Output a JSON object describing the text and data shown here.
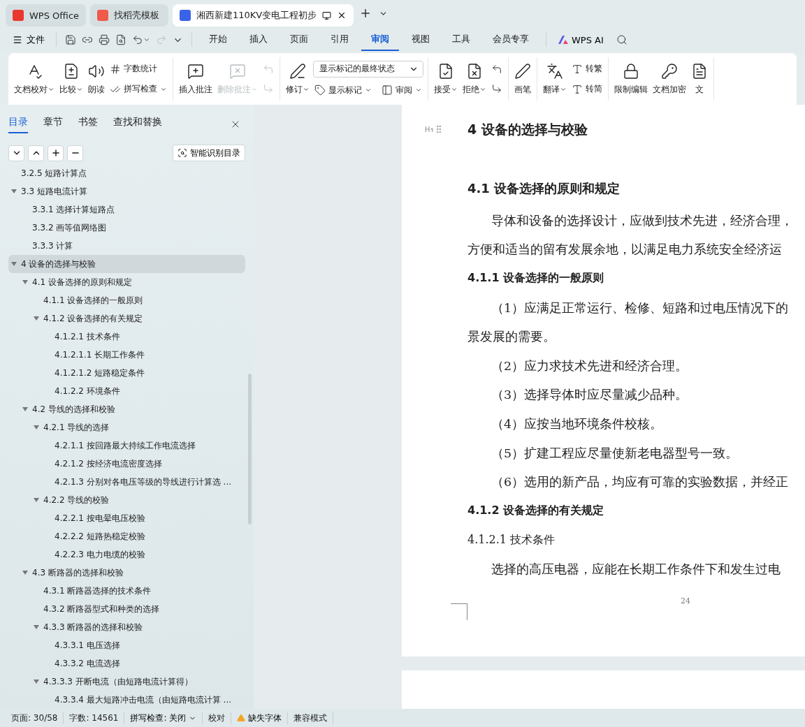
{
  "app_tabs": [
    {
      "label": "WPS Office",
      "selected": false,
      "kind": "wps"
    },
    {
      "label": "找稻壳模板",
      "selected": false,
      "kind": "docer"
    },
    {
      "label": "湘西新建110KV变电工程初步",
      "selected": true,
      "kind": "doc"
    }
  ],
  "menu": {
    "file": "文件",
    "tabs": [
      {
        "label": "开始",
        "selected": false
      },
      {
        "label": "插入",
        "selected": false
      },
      {
        "label": "页面",
        "selected": false
      },
      {
        "label": "引用",
        "selected": false
      },
      {
        "label": "审阅",
        "selected": true
      },
      {
        "label": "视图",
        "selected": false
      },
      {
        "label": "工具",
        "selected": false
      },
      {
        "label": "会员专享",
        "selected": false
      }
    ],
    "ai": "WPS AI"
  },
  "ribbon": [
    {
      "items": [
        {
          "kind": "big",
          "label": "文档校对",
          "dropdown": true,
          "disabled": false
        },
        {
          "kind": "big",
          "label": "比较",
          "dropdown": true,
          "disabled": false
        },
        {
          "kind": "big",
          "label": "朗读",
          "dropdown": false,
          "disabled": false
        },
        {
          "kind": "stack",
          "items": [
            {
              "label": "字数统计",
              "dropdown": false,
              "disabled": false
            },
            {
              "label": "拼写检查",
              "dropdown": true,
              "disabled": false
            }
          ]
        }
      ]
    },
    {
      "items": [
        {
          "kind": "big",
          "label": "插入批注",
          "dropdown": false,
          "disabled": false
        },
        {
          "kind": "big",
          "label": "删除批注",
          "dropdown": true,
          "disabled": true
        },
        {
          "kind": "stack",
          "items": [
            {
              "dropdown": false,
              "disabled": true
            },
            {
              "dropdown": false,
              "disabled": true
            }
          ]
        }
      ]
    },
    {
      "items": [
        {
          "kind": "big",
          "label": "修订",
          "dropdown": true,
          "disabled": false
        },
        {
          "kind": "select",
          "value": "显示标记的最终状态",
          "items": [
            {
              "label": "显示标记",
              "dropdown": true,
              "disabled": false
            },
            {
              "label": "审阅",
              "dropdown": true,
              "disabled": false
            }
          ]
        }
      ]
    },
    {
      "items": [
        {
          "kind": "big",
          "label": "接受",
          "dropdown": true,
          "disabled": false
        },
        {
          "kind": "big",
          "label": "拒绝",
          "dropdown": true,
          "disabled": false
        },
        {
          "kind": "stack",
          "items": [
            {
              "dropdown": false,
              "disabled": false
            },
            {
              "dropdown": false,
              "disabled": false
            }
          ]
        }
      ]
    },
    {
      "items": [
        {
          "kind": "big",
          "label": "画笔",
          "dropdown": false,
          "disabled": false
        }
      ]
    },
    {
      "items": [
        {
          "kind": "big",
          "label": "翻译",
          "dropdown": true,
          "disabled": false
        },
        {
          "kind": "stack",
          "items": [
            {
              "label": "转繁",
              "dropdown": false,
              "disabled": false
            },
            {
              "label": "转简",
              "dropdown": false,
              "disabled": false
            }
          ]
        }
      ]
    },
    {
      "items": [
        {
          "kind": "big",
          "label": "限制编辑",
          "dropdown": false,
          "disabled": false
        },
        {
          "kind": "big",
          "label": "文档加密",
          "dropdown": false,
          "disabled": false
        },
        {
          "kind": "big",
          "label": "文",
          "dropdown": false,
          "disabled": false
        }
      ]
    }
  ],
  "sidebar": {
    "tabs": [
      {
        "label": "目录",
        "selected": true
      },
      {
        "label": "章节",
        "selected": false
      },
      {
        "label": "书签",
        "selected": false
      },
      {
        "label": "查找和替换",
        "selected": false
      }
    ],
    "smart_button": "智能识别目录",
    "outline": [
      {
        "label": "3.2.5  短路计算点",
        "selected": false
      },
      {
        "label": "3.3  短路电流计算",
        "selected": false,
        "expanded": true,
        "children": [
          {
            "label": "3.3.1  选择计算短路点",
            "selected": false
          },
          {
            "label": "3.3.2  画等值网络图",
            "selected": false
          },
          {
            "label": "3.3.3  计算",
            "selected": false
          }
        ]
      },
      {
        "label": "4  设备的选择与校验",
        "selected": true,
        "expanded": true,
        "children": [
          {
            "label": "4.1  设备选择的原则和规定",
            "selected": false,
            "expanded": true,
            "children": [
              {
                "label": "4.1.1  设备选择的一般原则",
                "selected": false
              },
              {
                "label": "4.1.2  设备选择的有关规定",
                "selected": false,
                "expanded": true,
                "children": [
                  {
                    "label": "4.1.2.1  技术条件",
                    "selected": false
                  },
                  {
                    "label": "4.1.2.1.1  长期工作条件",
                    "selected": false
                  },
                  {
                    "label": "4.1.2.1.2  短路稳定条件",
                    "selected": false
                  },
                  {
                    "label": "4.1.2.2  环境条件",
                    "selected": false
                  }
                ]
              }
            ]
          },
          {
            "label": "4.2  导线的选择和校验",
            "selected": false,
            "expanded": true,
            "children": [
              {
                "label": "4.2.1  导线的选择",
                "selected": false,
                "expanded": true,
                "children": [
                  {
                    "label": "4.2.1.1  按回路最大持续工作电流选择",
                    "selected": false
                  },
                  {
                    "label": "4.2.1.2  按经济电流密度选择",
                    "selected": false
                  },
                  {
                    "label": "4.2.1.3  分别对各电压等级的导线进行计算选 ...",
                    "selected": false
                  }
                ]
              },
              {
                "label": "4.2.2  导线的校验",
                "selected": false,
                "expanded": true,
                "children": [
                  {
                    "label": "4.2.2.1  按电晕电压校验",
                    "selected": false
                  },
                  {
                    "label": "4.2.2.2  短路热稳定校验",
                    "selected": false
                  },
                  {
                    "label": "4.2.2.3  电力电缆的校验",
                    "selected": false
                  }
                ]
              }
            ]
          },
          {
            "label": "4.3  断路器的选择和校验",
            "selected": false,
            "expanded": true,
            "children": [
              {
                "label": "4.3.1  断路器选择的技术条件",
                "selected": false
              },
              {
                "label": "4.3.2  断路器型式和种类的选择",
                "selected": false
              },
              {
                "label": "4.3.3  断路器的选择和校验",
                "selected": false,
                "expanded": true,
                "children": [
                  {
                    "label": "4.3.3.1  电压选择",
                    "selected": false
                  },
                  {
                    "label": "4.3.3.2  电流选择",
                    "selected": false
                  }
                ]
              },
              {
                "label": "4.3.3.3  开断电流（由短路电流计算得）",
                "selected": false,
                "expanded": true,
                "children": [
                  {
                    "label": "4.3.3.4  最大短路冲击电流（由短路电流计算 ...",
                    "selected": false
                  }
                ]
              }
            ]
          }
        ]
      }
    ]
  },
  "document": {
    "lines": [
      {
        "kind": "h1",
        "text": "4  设备的选择与校验"
      },
      {
        "kind": "h2",
        "text": "4.1  设备选择的原则和规定"
      },
      {
        "kind": "indent",
        "text": "导体和设备的选择设计，应做到技术先进，经济合理，"
      },
      {
        "kind": "body",
        "text": "方便和适当的留有发展余地，以满足电力系统安全经济运"
      },
      {
        "kind": "h3",
        "text": "4.1.1  设备选择的一般原则"
      },
      {
        "kind": "indent",
        "text": "（1）应满足正常运行、检修、短路和过电压情况下的"
      },
      {
        "kind": "body",
        "text": "景发展的需要。"
      },
      {
        "kind": "indent",
        "text": "（2）应力求技术先进和经济合理。"
      },
      {
        "kind": "indent",
        "text": "（3）选择导体时应尽量减少品种。"
      },
      {
        "kind": "indent",
        "text": "（4）应按当地环境条件校核。"
      },
      {
        "kind": "indent",
        "text": "（5）扩建工程应尽量使新老电器型号一致。"
      },
      {
        "kind": "indent",
        "text": "（6）选用的新产品，均应有可靠的实验数据，并经正"
      },
      {
        "kind": "h3",
        "text": "4.1.2  设备选择的有关规定"
      },
      {
        "kind": "h4",
        "text": "4.1.2.1  技术条件"
      },
      {
        "kind": "indent",
        "text": "选择的高压电器，应能在长期工作条件下和发生过电"
      }
    ],
    "page_number": "24"
  },
  "status_bar": [
    {
      "kind": "text",
      "text": "页面: 30/58"
    },
    {
      "kind": "text",
      "text": "字数: 14561"
    },
    {
      "kind": "dropdown",
      "text": "拼写检查: 关闭"
    },
    {
      "kind": "text",
      "text": "校对"
    },
    {
      "kind": "warning",
      "text": "缺失字体"
    },
    {
      "kind": "text",
      "text": "兼容模式"
    }
  ]
}
